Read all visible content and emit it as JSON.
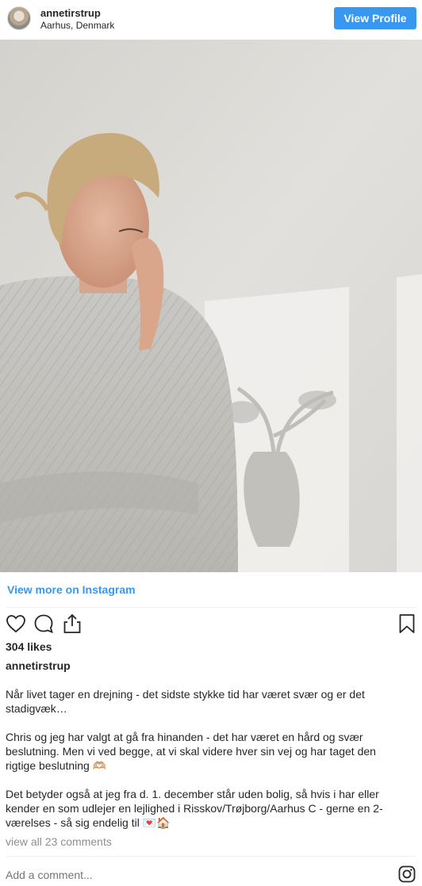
{
  "header": {
    "username": "annetirstrup",
    "location": "Aarhus, Denmark",
    "view_profile_label": "View Profile"
  },
  "post": {
    "view_more_label": "View more on Instagram",
    "likes": "304 likes",
    "caption_user": "annetirstrup",
    "caption_paragraphs": [
      "Når livet tager en drejning - det sidste stykke tid har været svær og er det stadigvæk…",
      "Chris og jeg har valgt at gå fra hinanden - det har været en hård og svær beslutning. Men vi ved begge, at vi skal videre hver sin vej og har taget den rigtige beslutning 🫶🏼",
      "Det betyder også at jeg fra d. 1. december står uden bolig, så hvis i har eller kender en som udlejer en lejlighed i Risskov/Trøjborg/Aarhus C - gerne en 2-værelses - så sig endelig til 💌🏠"
    ],
    "comments_link": "view all 23 comments",
    "add_comment_placeholder": "Add a comment..."
  },
  "icons": {
    "like": "heart-icon",
    "comment": "comment-bubble-icon",
    "share": "share-icon",
    "save": "bookmark-icon",
    "brand": "instagram-logo-icon"
  },
  "colors": {
    "accent": "#3897f0",
    "text": "#262626",
    "muted": "#8e8e8e",
    "divider": "#efefef"
  }
}
